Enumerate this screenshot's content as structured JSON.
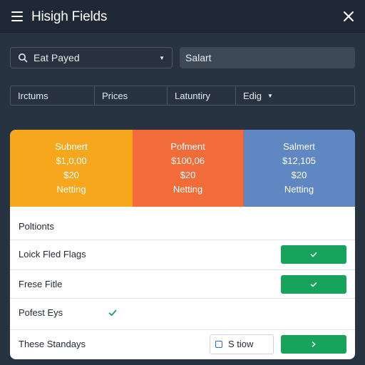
{
  "header": {
    "title": "Hisigh Fields"
  },
  "controls": {
    "select_value": "Eat Payed",
    "text_field_value": "Salart"
  },
  "filters": [
    {
      "label": "Irctums"
    },
    {
      "label": "Prices"
    },
    {
      "label": "Latuntiry"
    },
    {
      "label": "Edig"
    }
  ],
  "tiles": [
    {
      "title": "Subnert",
      "amount": "$1,0,00",
      "sub": "$20",
      "status": "Netting",
      "color": "#f7a71c"
    },
    {
      "title": "Pofment",
      "amount": "$100,06",
      "sub": "$20",
      "status": "Netting",
      "color": "#f26c3a"
    },
    {
      "title": "Salmert",
      "amount": "$12,105",
      "sub": "$20",
      "status": "Netting",
      "color": "#5f87c1"
    }
  ],
  "list": {
    "section_label": "Poltionts",
    "rows": [
      {
        "label": "Loick Fled Flags",
        "control": "button-check"
      },
      {
        "label": "Frese Fitle",
        "control": "button-check"
      },
      {
        "label": "Pofest Eys",
        "control": "plain-check"
      },
      {
        "label": "These Standays",
        "control": "input-and-button",
        "input_value": "S tiow"
      }
    ]
  },
  "colors": {
    "header_bg": "#1f2935",
    "page_bg": "#283341",
    "accent_green": "#17a35b",
    "input_icon_blue": "#2d6ec7"
  },
  "icons": {
    "menu": "hamburger-menu-icon",
    "close": "close-icon",
    "search": "search-icon",
    "dropdown": "chevron-down-icon",
    "check": "check-icon",
    "arrow": "chevron-right-icon"
  }
}
